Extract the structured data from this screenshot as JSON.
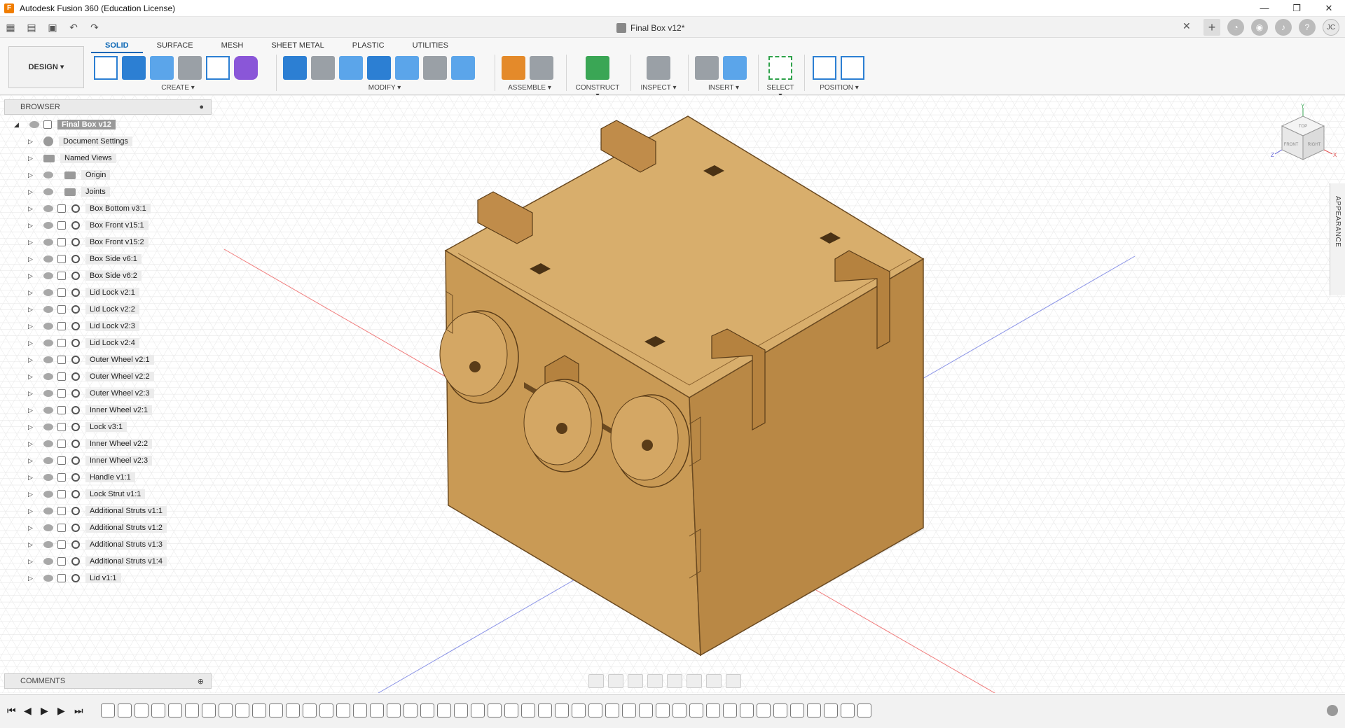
{
  "window": {
    "title": "Autodesk Fusion 360 (Education License)",
    "app_icon": "F",
    "controls": [
      "—",
      "❐",
      "✕"
    ]
  },
  "document": {
    "tab_title": "Final Box v12*",
    "close": "✕"
  },
  "toolbar": {
    "user_initials": "JC",
    "tabs": [
      "SOLID",
      "SURFACE",
      "MESH",
      "SHEET METAL",
      "PLASTIC",
      "UTILITIES"
    ],
    "active_tab": "SOLID",
    "design_button": "DESIGN ▾",
    "groups": [
      {
        "label": "CREATE ▾"
      },
      {
        "label": "MODIFY ▾"
      },
      {
        "label": "ASSEMBLE ▾"
      },
      {
        "label": "CONSTRUCT ▾"
      },
      {
        "label": "INSPECT ▾"
      },
      {
        "label": "INSERT ▾"
      },
      {
        "label": "SELECT ▾"
      },
      {
        "label": "POSITION ▾"
      }
    ]
  },
  "browser": {
    "title": "BROWSER",
    "root": "Final Box v12",
    "items": [
      {
        "label": "Document Settings",
        "type": "settings"
      },
      {
        "label": "Named Views",
        "type": "folder"
      },
      {
        "label": "Origin",
        "type": "folder"
      },
      {
        "label": "Joints",
        "type": "folder"
      },
      {
        "label": "Box Bottom v3:1",
        "type": "component"
      },
      {
        "label": "Box Front v15:1",
        "type": "component"
      },
      {
        "label": "Box Front v15:2",
        "type": "component"
      },
      {
        "label": "Box Side v6:1",
        "type": "component"
      },
      {
        "label": "Box Side v6:2",
        "type": "component"
      },
      {
        "label": "Lid Lock v2:1",
        "type": "component"
      },
      {
        "label": "Lid Lock v2:2",
        "type": "component"
      },
      {
        "label": "Lid Lock v2:3",
        "type": "component"
      },
      {
        "label": "Lid Lock v2:4",
        "type": "component"
      },
      {
        "label": "Outer Wheel v2:1",
        "type": "component"
      },
      {
        "label": "Outer Wheel v2:2",
        "type": "component"
      },
      {
        "label": "Outer Wheel v2:3",
        "type": "component"
      },
      {
        "label": "Inner Wheel v2:1",
        "type": "component"
      },
      {
        "label": "Lock v3:1",
        "type": "component"
      },
      {
        "label": "Inner Wheel v2:2",
        "type": "component"
      },
      {
        "label": "Inner Wheel v2:3",
        "type": "component"
      },
      {
        "label": "Handle v1:1",
        "type": "component"
      },
      {
        "label": "Lock Strut v1:1",
        "type": "component"
      },
      {
        "label": "Additional Struts v1:1",
        "type": "component"
      },
      {
        "label": "Additional Struts v1:2",
        "type": "component"
      },
      {
        "label": "Additional Struts v1:3",
        "type": "component"
      },
      {
        "label": "Additional Struts v1:4",
        "type": "component"
      },
      {
        "label": "Lid v1:1",
        "type": "component"
      }
    ]
  },
  "comments": {
    "title": "COMMENTS"
  },
  "appearance": {
    "title": "APPEARANCE"
  },
  "viewcube": {
    "top": "TOP",
    "front": "FRONT",
    "right": "RIGHT",
    "axis_x": "X",
    "axis_y": "Y",
    "axis_z": "Z"
  },
  "colors": {
    "wood": "#c99a55",
    "wood_dark": "#a8783d",
    "wood_light": "#d8ae6c",
    "accent_blue": "#0a66b5",
    "grid": "#e4e4e4",
    "axis_red": "#f07b7b",
    "axis_blue": "#8a93e6"
  },
  "timeline": {
    "controls": [
      "⏮",
      "◀",
      "▶",
      "▶",
      "⏭"
    ],
    "feature_count": 46
  }
}
